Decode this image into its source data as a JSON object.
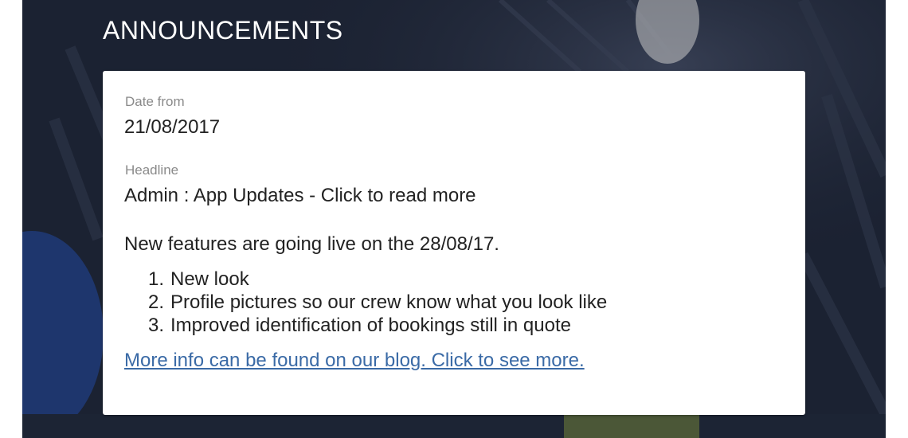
{
  "section": {
    "title": "ANNOUNCEMENTS"
  },
  "announcement": {
    "date_label": "Date from",
    "date_value": "21/08/2017",
    "headline_label": "Headline",
    "headline_value": "Admin : App Updates - Click to read more",
    "intro": "New features are going live on the 28/08/17.",
    "features": [
      {
        "number": "1.",
        "text": "New look"
      },
      {
        "number": "2.",
        "text": "Profile pictures so our crew know what you look like"
      },
      {
        "number": "3.",
        "text": "Improved identification of bookings still in quote"
      }
    ],
    "link_text": "More info can be found on our blog. Click to see more."
  },
  "colors": {
    "hero_background": "#1c2333",
    "card_background": "#ffffff",
    "label_color": "#8a8a8a",
    "link_color": "#3a6aa6"
  }
}
